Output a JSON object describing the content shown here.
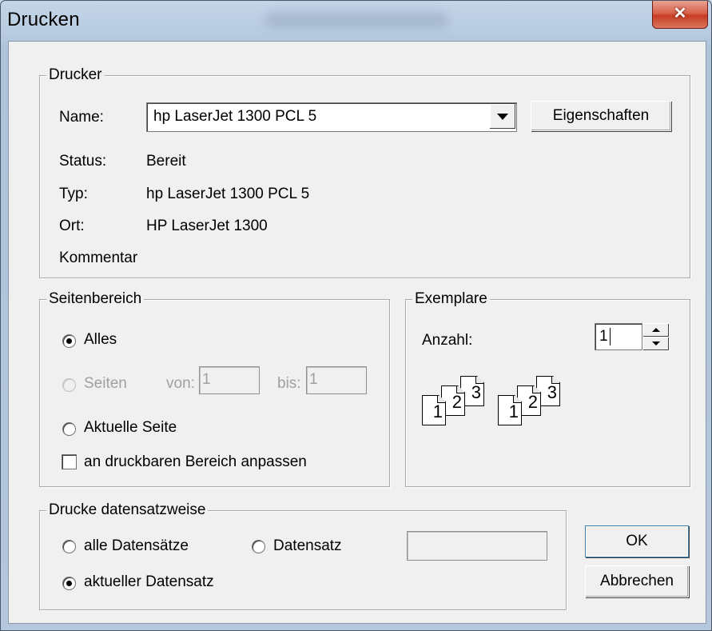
{
  "window": {
    "title": "Drucken",
    "close_glyph": "✕"
  },
  "printer": {
    "legend": "Drucker",
    "name_label": "Name:",
    "name_value": "hp LaserJet 1300 PCL 5",
    "properties_button": "Eigenschaften",
    "status_label": "Status:",
    "status_value": "Bereit",
    "type_label": "Typ:",
    "type_value": "hp LaserJet 1300 PCL 5",
    "location_label": "Ort:",
    "location_value": "HP LaserJet 1300",
    "comment_label": "Kommentar"
  },
  "page_range": {
    "legend": "Seitenbereich",
    "all_label": "Alles",
    "pages_label": "Seiten",
    "from_label": "von:",
    "from_value": "1",
    "to_label": "bis:",
    "to_value": "1",
    "current_page_label": "Aktuelle Seite",
    "fit_label": "an druckbaren Bereich anpassen"
  },
  "copies": {
    "legend": "Exemplare",
    "count_label": "Anzahl:",
    "count_value": "1",
    "collate_pages": [
      "1",
      "2",
      "3"
    ]
  },
  "records": {
    "legend": "Drucke datensatzweise",
    "all_records_label": "alle Datensätze",
    "record_label": "Datensatz",
    "record_value": "",
    "current_record_label": "aktueller Datensatz"
  },
  "buttons": {
    "ok": "OK",
    "cancel": "Abbrechen"
  }
}
